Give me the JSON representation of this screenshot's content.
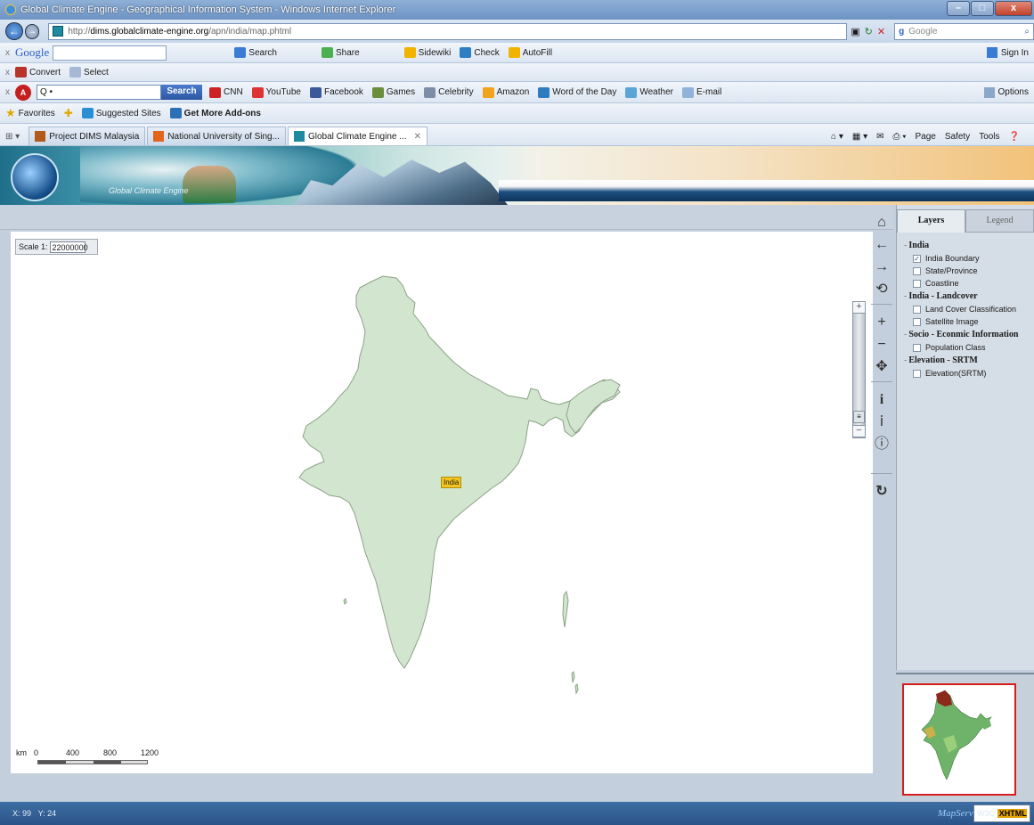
{
  "window": {
    "title": "Global Climate Engine - Geographical Information System - Windows Internet Explorer",
    "minimize": "–",
    "maximize": "□",
    "close": "x"
  },
  "address_bar": {
    "url_prefix": "http://",
    "url_domain": "dims.globalclimate-engine.org",
    "url_path": "/apn/india/map.phtml",
    "search_engine": "Google"
  },
  "google_toolbar": {
    "close": "x",
    "logo": "Google",
    "items": [
      "Search",
      "Share",
      "Sidewiki",
      "Check",
      "AutoFill"
    ],
    "sign_in": "Sign In"
  },
  "convert_bar": {
    "close": "x",
    "convert": "Convert",
    "select": "Select"
  },
  "search_toolbar": {
    "close": "x",
    "search_placeholder": "Q •",
    "search_button": "Search",
    "links": [
      "CNN",
      "YouTube",
      "Facebook",
      "Games",
      "Celebrity",
      "Amazon",
      "Word of the Day",
      "Weather",
      "E-mail"
    ],
    "options": "Options"
  },
  "favorites_bar": {
    "favorites": "Favorites",
    "suggested_sites": "Suggested Sites",
    "get_more_addons": "Get More Add-ons"
  },
  "tabs": [
    {
      "label": "Project DIMS Malaysia",
      "active": false
    },
    {
      "label": "National University of Sing...",
      "active": false
    },
    {
      "label": "Global Climate Engine ...",
      "active": true
    }
  ],
  "command_bar": {
    "page": "Page",
    "safety": "Safety",
    "tools": "Tools"
  },
  "banner": {
    "brand_text": "Global Climate Engine"
  },
  "map": {
    "scale_label": "Scale 1:",
    "scale_value": "22000000",
    "country_label": "India",
    "scalebar_unit": "km",
    "scalebar_ticks": [
      "0",
      "400",
      "800",
      "1200"
    ]
  },
  "map_tools": [
    "home-icon",
    "back-arrow-icon",
    "forward-arrow-icon",
    "refresh-map-icon",
    "zoom-in-icon",
    "zoom-out-icon",
    "pan-icon",
    "info-icon",
    "identify-icon",
    "query-icon",
    "reload-icon"
  ],
  "side_panel": {
    "tab_layers": "Layers",
    "tab_legend": "Legend",
    "groups": [
      {
        "name": "India",
        "layers": [
          {
            "label": "India Boundary",
            "checked": true
          },
          {
            "label": "State/Province",
            "checked": false
          },
          {
            "label": "Coastline",
            "checked": false
          }
        ]
      },
      {
        "name": "India - Landcover",
        "layers": [
          {
            "label": "Land Cover Classification",
            "checked": false
          },
          {
            "label": "Satellite Image",
            "checked": false
          }
        ]
      },
      {
        "name": "Socio - Econmic Information",
        "layers": [
          {
            "label": "Population Class",
            "checked": false
          }
        ]
      },
      {
        "name": "Elevation - SRTM",
        "layers": [
          {
            "label": "Elevation(SRTM)",
            "checked": false
          }
        ]
      }
    ]
  },
  "status": {
    "x_label": "X:",
    "x_value": "99",
    "y_label": "Y:",
    "y_value": "24",
    "badge_mapserver": "MapServer",
    "badge_w3c": "W3C",
    "badge_xhtml": "XHTML 1.0"
  },
  "colors": {
    "map_land": "#d2e6cf",
    "map_border": "#8aa384",
    "label_bg": "#f2c420",
    "overview_border": "#d51d1d"
  }
}
